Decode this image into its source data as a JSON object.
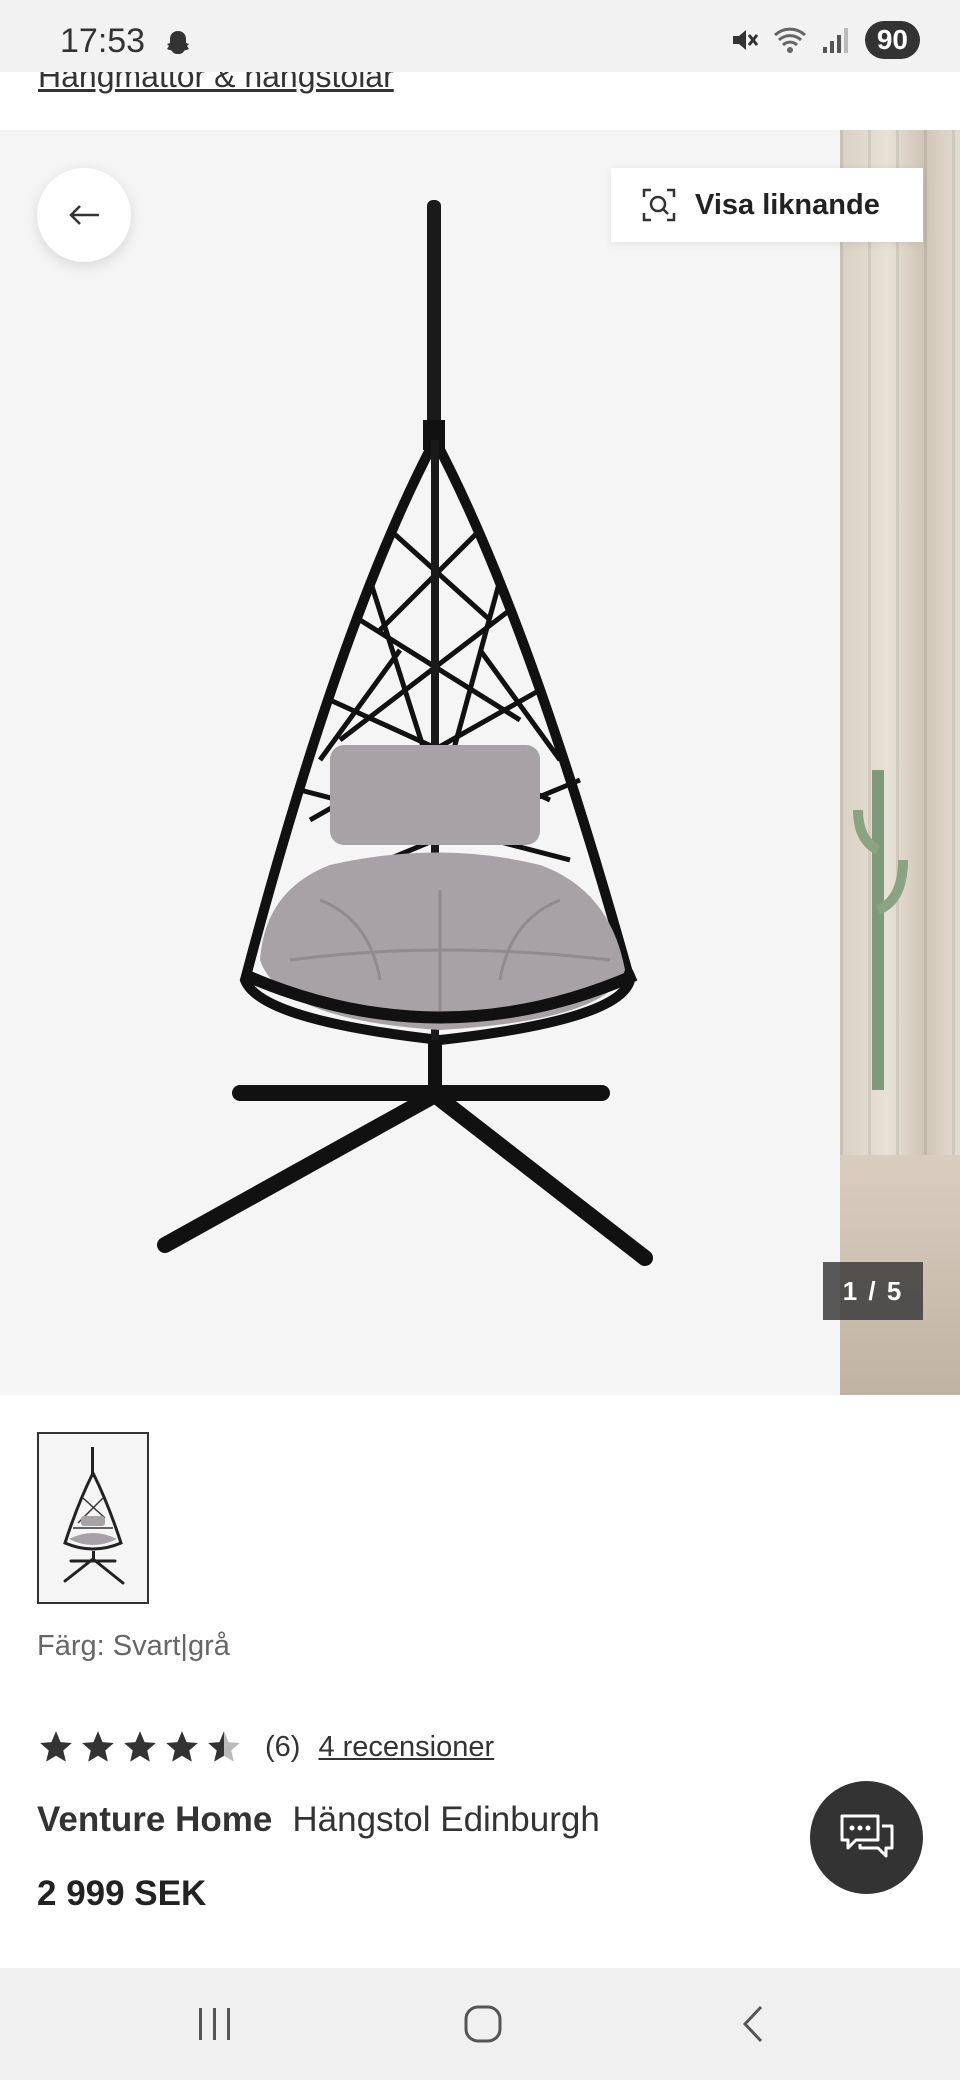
{
  "status_bar": {
    "time": "17:53",
    "battery": "90"
  },
  "breadcrumb": {
    "label": "Hängmattor & hängstolar"
  },
  "gallery": {
    "back_icon": "arrow-left-icon",
    "similar_button_label": "Visa liknande",
    "similar_icon": "visual-search-icon",
    "counter": "1 / 5"
  },
  "product": {
    "color_label": "Färg: Svart|grå",
    "rating": {
      "value": 4.5,
      "max": 5,
      "count": "(6)",
      "reviews_link": "4 recensioner"
    },
    "brand": "Venture Home",
    "name": "Hängstol Edinburgh",
    "price": "2 999 SEK"
  },
  "chat": {
    "icon": "chat-bubbles-icon"
  },
  "nav": {
    "recents_icon": "recents-icon",
    "home_icon": "home-icon",
    "back_icon": "back-chevron-icon"
  },
  "colors": {
    "accent_dark": "#333333",
    "gallery_bg": "#f5f5f5",
    "cushion": "#a6a2a6"
  }
}
